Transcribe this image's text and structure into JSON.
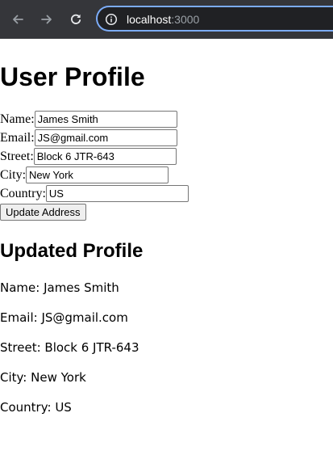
{
  "browser": {
    "url_host": "localhost",
    "url_port": ":3000",
    "icons": {
      "back": "arrow-left-icon",
      "forward": "arrow-right-icon",
      "reload": "reload-icon",
      "site_info": "info-icon"
    },
    "colors": {
      "toolbar_bg": "#35363a",
      "address_border": "#7cacf8"
    }
  },
  "form": {
    "title": "User Profile",
    "fields": {
      "name": {
        "label": "Name:",
        "value": "James Smith"
      },
      "email": {
        "label": "Email:",
        "value": "JS@gmail.com"
      },
      "street": {
        "label": "Street:",
        "value": "Block 6 JTR-643"
      },
      "city": {
        "label": "City:",
        "value": "New York"
      },
      "country": {
        "label": "Country:",
        "value": "US"
      }
    },
    "submit_label": "Update Address"
  },
  "updated": {
    "title": "Updated Profile",
    "lines": [
      "Name: James Smith",
      "Email: JS@gmail.com",
      "Street: Block 6 JTR-643",
      "City: New York",
      "Country: US"
    ]
  }
}
